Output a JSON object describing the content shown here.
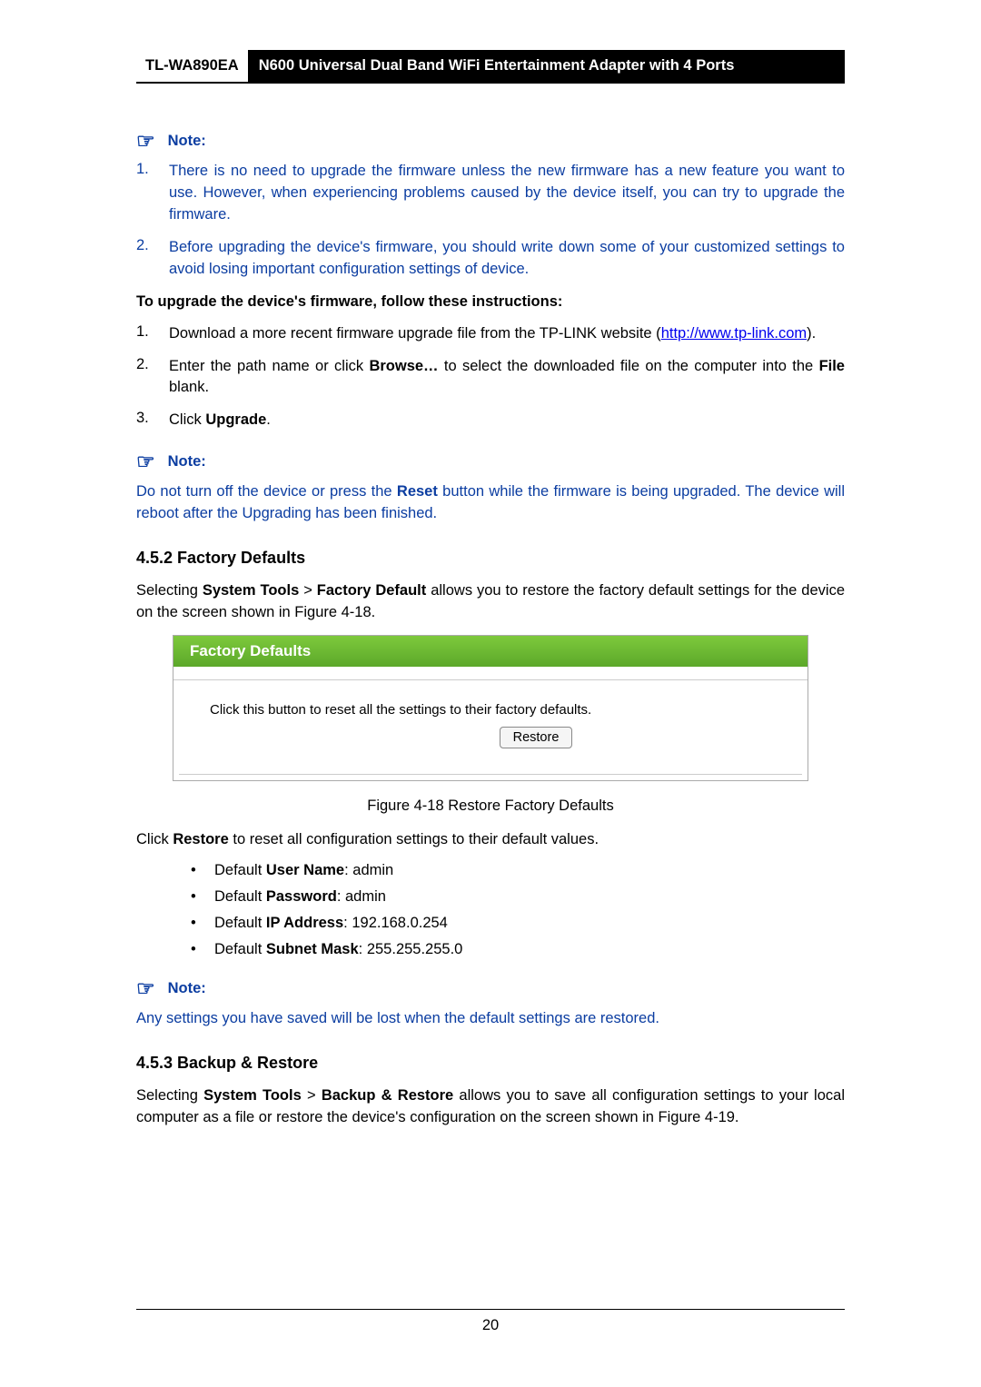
{
  "header": {
    "model": "TL-WA890EA",
    "title": "N600 Universal Dual Band WiFi Entertainment Adapter with 4 Ports"
  },
  "note1": {
    "label": "Note:",
    "items": [
      "There is no need to upgrade the firmware unless the new firmware has a new feature you want to use. However, when experiencing problems caused by the device itself, you can try to upgrade the firmware.",
      "Before upgrading the device's firmware, you should write down some of your customized settings to avoid losing important configuration settings of device."
    ]
  },
  "upgrade": {
    "heading": "To upgrade the device's firmware, follow these instructions:",
    "steps": {
      "s1_pre": "Download a more recent firmware upgrade file from the TP-LINK website (",
      "s1_link": "http://www.tp-link.com",
      "s1_post": ").",
      "s2_pre": "Enter the path name or click ",
      "s2_bold": "Browse…",
      "s2_mid": " to select the downloaded file on the computer into the ",
      "s2_bold2": "File",
      "s2_post": " blank.",
      "s3_pre": "Click ",
      "s3_bold": "Upgrade",
      "s3_post": "."
    }
  },
  "note2": {
    "label": "Note:",
    "text_pre": "Do not turn off the device or press the ",
    "text_bold": "Reset",
    "text_post": " button while the firmware is being upgraded. The device will reboot after the Upgrading has been finished."
  },
  "section452": {
    "heading": "4.5.2  Factory Defaults",
    "para_pre": "Selecting ",
    "para_b1": "System Tools",
    "para_sep": " > ",
    "para_b2": "Factory Default",
    "para_post": " allows you to restore the factory default settings for the device on the screen shown in Figure 4-18."
  },
  "figure": {
    "title": "Factory Defaults",
    "body_text": "Click this button to reset all the settings to their factory defaults.",
    "button": "Restore",
    "caption": "Figure 4-18 Restore Factory Defaults"
  },
  "restore": {
    "para_pre": "Click ",
    "para_b": "Restore",
    "para_post": " to reset all configuration settings to their default values.",
    "bullets": {
      "b1_lbl": "User Name",
      "b1_val": ": admin",
      "b2_lbl": "Password",
      "b2_val": ": admin",
      "b3_lbl": "IP Address",
      "b3_val": ": 192.168.0.254",
      "b4_lbl": "Subnet Mask",
      "b4_val": ": 255.255.255.0",
      "prefix": "Default "
    }
  },
  "note3": {
    "label": "Note:",
    "text": "Any settings you have saved will be lost when the default settings are restored."
  },
  "section453": {
    "heading": "4.5.3  Backup & Restore",
    "para_pre": "Selecting ",
    "para_b1": "System Tools",
    "para_sep": " > ",
    "para_b2": "Backup & Restore",
    "para_post": " allows you to save all configuration settings to your local computer as a file or restore the device's configuration on the screen shown in Figure 4-19."
  },
  "footer": {
    "page": "20"
  }
}
